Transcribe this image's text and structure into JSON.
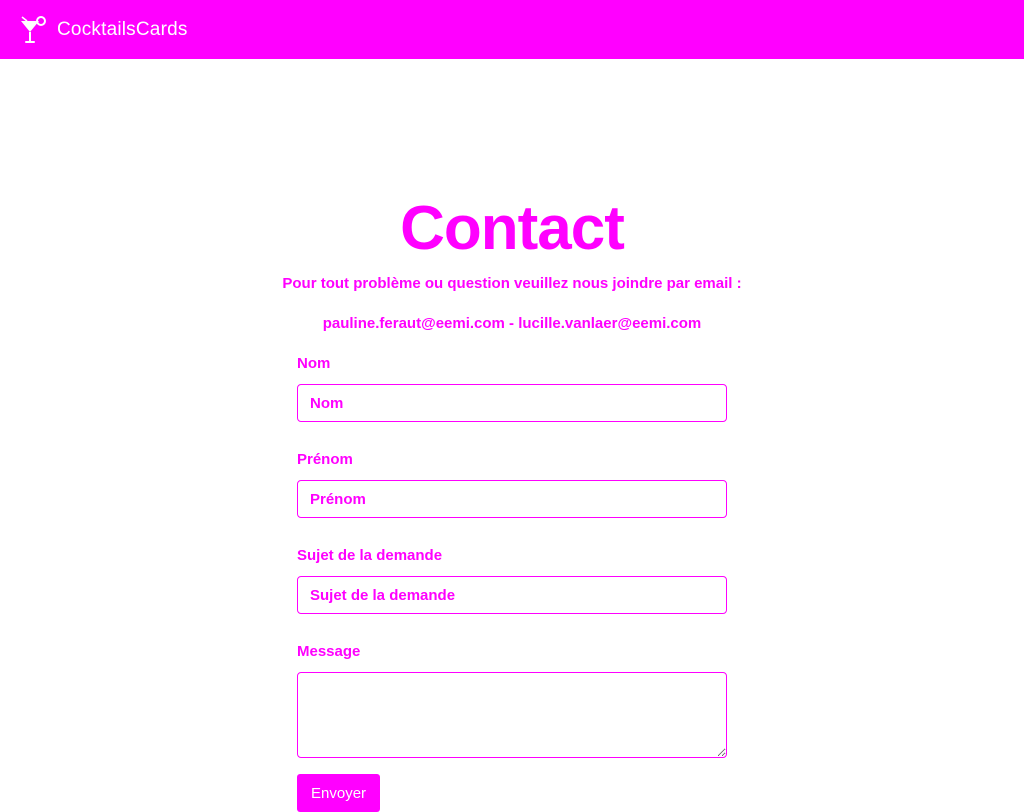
{
  "navbar": {
    "brand_icon": "cocktail-glass-icon",
    "brand_name": "CocktailsCards"
  },
  "main": {
    "title": "Contact",
    "intro": "Pour tout problème ou question veuillez nous joindre par email :",
    "emails": "pauline.feraut@eemi.com - lucille.vanlaer@eemi.com"
  },
  "form": {
    "nom": {
      "label": "Nom",
      "placeholder": "Nom",
      "value": ""
    },
    "prenom": {
      "label": "Prénom",
      "placeholder": "Prénom",
      "value": ""
    },
    "sujet": {
      "label": "Sujet de la demande",
      "placeholder": "Sujet de la demande",
      "value": ""
    },
    "message": {
      "label": "Message",
      "value": ""
    },
    "submit_label": "Envoyer"
  },
  "colors": {
    "accent": "#ff00ff",
    "background": "#ffffff",
    "text_on_accent": "#ffffff"
  }
}
